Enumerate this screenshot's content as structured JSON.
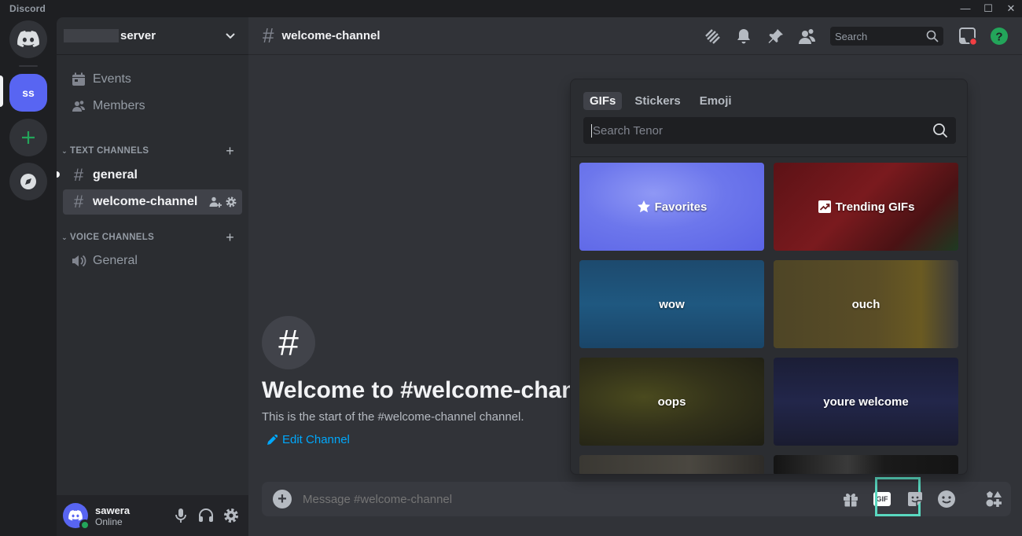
{
  "window": {
    "app_name": "Discord",
    "controls": {
      "minimize": "—",
      "maximize": "☐",
      "close": "✕"
    }
  },
  "server_rail": {
    "home_icon": "discord-logo-icon",
    "servers": [
      {
        "initials": "ss",
        "selected": true
      }
    ],
    "add_server_icon": "plus-icon",
    "explore_icon": "compass-icon"
  },
  "sidebar": {
    "server_name": "server",
    "server_name_redacted_prefix": true,
    "top_items": [
      {
        "label": "Events",
        "icon": "calendar-icon"
      },
      {
        "label": "Members",
        "icon": "members-icon"
      }
    ],
    "categories": [
      {
        "label": "TEXT CHANNELS",
        "channels": [
          {
            "name": "general",
            "unread": true,
            "active": false
          },
          {
            "name": "welcome-channel",
            "unread": false,
            "active": true
          }
        ]
      },
      {
        "label": "VOICE CHANNELS",
        "channels": [
          {
            "name": "General",
            "type": "voice"
          }
        ]
      }
    ],
    "user": {
      "name": "sawera",
      "status": "Online",
      "status_color": "#23a55a"
    }
  },
  "header": {
    "channel_name": "welcome-channel",
    "search_placeholder": "Search",
    "icons": [
      "threads-icon",
      "bell-icon",
      "pin-icon",
      "members-list-icon",
      "search-icon",
      "inbox-icon",
      "help-icon"
    ]
  },
  "chat": {
    "welcome_title": "Welcome to #welcome-channel!",
    "welcome_desc": "This is the start of the #welcome-channel channel.",
    "edit_channel": "Edit Channel",
    "composer_placeholder": "Message #welcome-channel",
    "composer_buttons": [
      "gift-icon",
      "gif-icon",
      "sticker-icon",
      "emoji-icon"
    ],
    "gif_button_label": "GIF",
    "highlight_color": "#5ad8c0"
  },
  "picker": {
    "tabs": [
      {
        "label": "GIFs",
        "active": true
      },
      {
        "label": "Stickers",
        "active": false
      },
      {
        "label": "Emoji",
        "active": false
      }
    ],
    "search_placeholder": "Search Tenor",
    "tiles": [
      {
        "label": "Favorites",
        "icon": "star-icon"
      },
      {
        "label": "Trending GIFs",
        "icon": "trending-icon"
      },
      {
        "label": "wow"
      },
      {
        "label": "ouch"
      },
      {
        "label": "oops"
      },
      {
        "label": "youre welcome"
      }
    ]
  },
  "colors": {
    "accent": "#5865f2",
    "link": "#00a8fc",
    "online": "#23a55a",
    "help": "#23a55a",
    "notification": "#f23f43"
  }
}
